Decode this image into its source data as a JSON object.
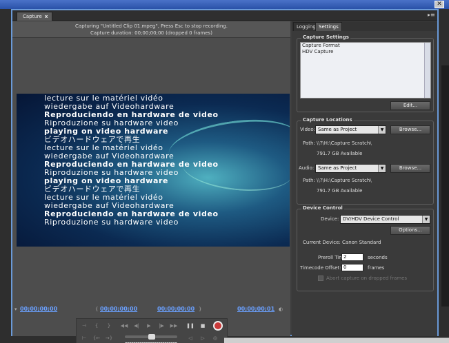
{
  "window": {
    "close_glyph": "✕"
  },
  "panel_tabs": {
    "capture_label": "Capture",
    "capture_close": "x",
    "menu_glyph": "▸≡"
  },
  "status": {
    "line1": "Capturing \"Untitled Clip 01.mpeg\", Press Esc to stop recording.",
    "line2": "Capture duration: 00;00;00;00 (dropped 0 frames)"
  },
  "video_lines": [
    {
      "text": "lecture sur le matériel vidéo",
      "bold": false
    },
    {
      "text": "wiedergabe auf Videohardware",
      "bold": false
    },
    {
      "text": "Reproduciendo en hardware de video",
      "bold": true
    },
    {
      "text": "Riproduzione su hardware video",
      "bold": false
    },
    {
      "text": "playing on video hardware",
      "bold": true
    },
    {
      "text": "ビデオハードウェアで再生",
      "bold": false
    },
    {
      "text": "lecture sur le matériel vidéo",
      "bold": false
    },
    {
      "text": "wiedergabe auf Videohardware",
      "bold": false
    },
    {
      "text": "Reproduciendo en hardware de video",
      "bold": true
    },
    {
      "text": "Riproduzione su hardware video",
      "bold": false
    },
    {
      "text": "playing on video hardware",
      "bold": true
    },
    {
      "text": "ビデオハードウェアで再生",
      "bold": false
    },
    {
      "text": "lecture sur le matériel vidéo",
      "bold": false
    },
    {
      "text": "wiedergabe auf Videohardware",
      "bold": false
    },
    {
      "text": "Reproduciendo en hardware de video",
      "bold": true
    },
    {
      "text": "Riproduzione su hardware video",
      "bold": false
    }
  ],
  "timecodes": {
    "current": "00;00;00;00",
    "in_point": "00;00;00;00",
    "out_point": "00;00;00;00",
    "duration": "00;00;00;01"
  },
  "right_tabs": {
    "logging": "Logging",
    "settings": "Settings"
  },
  "capture_settings": {
    "title": "Capture Settings",
    "items": [
      "Capture Format",
      "HDV Capture"
    ],
    "edit_button": "Edit..."
  },
  "capture_locations": {
    "title": "Capture Locations",
    "video_label": "Video:",
    "video_value": "Same as Project",
    "video_path_label": "Path:",
    "video_path": "\\\\?\\H:\\Capture Scratch\\",
    "video_available": "791.7 GB Available",
    "audio_label": "Audio:",
    "audio_value": "Same as Project",
    "audio_path_label": "Path:",
    "audio_path": "\\\\?\\H:\\Capture Scratch\\",
    "audio_available": "791.7 GB Available",
    "browse_label": "Browse..."
  },
  "device_control": {
    "title": "Device Control",
    "device_label": "Device:",
    "device_value": "DV/HDV Device Control",
    "options_button": "Options...",
    "current_device": "Current Device: Canon Standard",
    "preroll_label": "Preroll Time:",
    "preroll_value": "2",
    "preroll_unit": "seconds",
    "offset_label": "Timecode Offset:",
    "offset_value": "0",
    "offset_unit": "frames",
    "abort_label": "Abort capture on dropped frames"
  },
  "colors": {
    "timecode": "#6aa0ff",
    "record": "#c93a3a",
    "frame": "#6a9ad8"
  }
}
